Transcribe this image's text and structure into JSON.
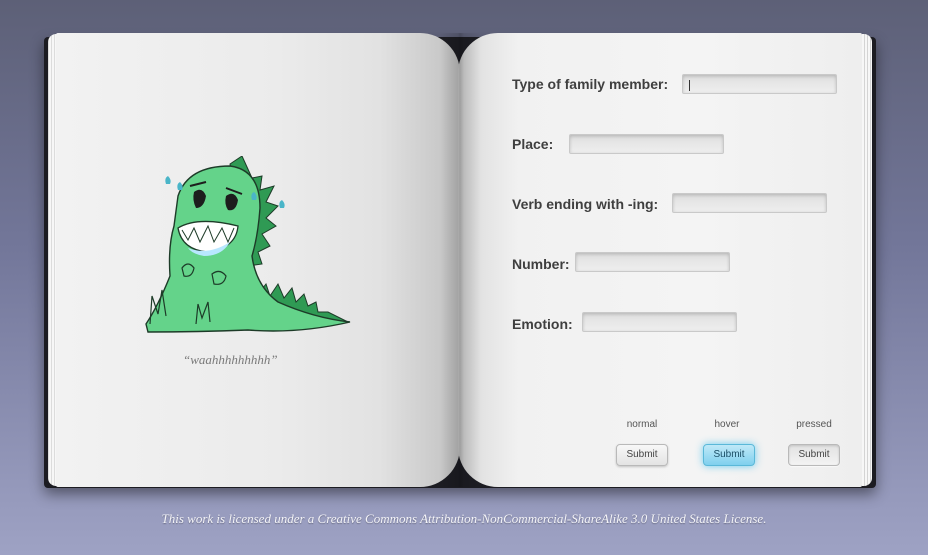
{
  "caption": "“waahhhhhhhhh”",
  "form": {
    "fields": [
      {
        "label": "Type of family member:",
        "value": "",
        "placeholder": ""
      },
      {
        "label": "Place:",
        "value": "",
        "placeholder": ""
      },
      {
        "label": "Verb ending with -ing:",
        "value": "",
        "placeholder": ""
      },
      {
        "label": "Number:",
        "value": "",
        "placeholder": ""
      },
      {
        "label": "Emotion:",
        "value": "",
        "placeholder": ""
      }
    ]
  },
  "buttons": {
    "normal": {
      "state_label": "normal",
      "label": "Submit"
    },
    "hover": {
      "state_label": "hover",
      "label": "Submit"
    },
    "pressed": {
      "state_label": "pressed",
      "label": "Submit"
    }
  },
  "license": "This work is licensed under a Creative Commons Attribution-NonCommercial-ShareAlike 3.0 United States License.",
  "colors": {
    "dino_green": "#64d38a",
    "dino_dark_green": "#2f9a54",
    "hover_blue": "#7fd0ee"
  }
}
